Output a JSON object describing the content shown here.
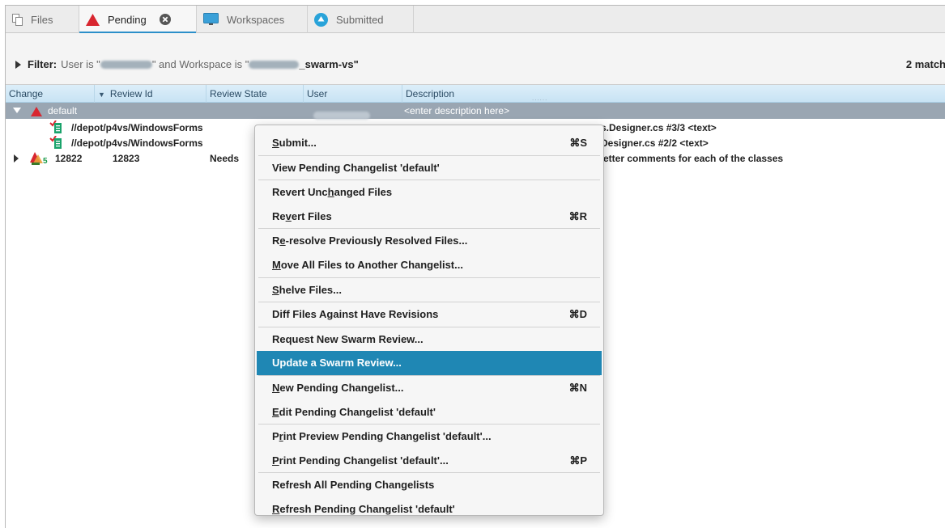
{
  "tabs": [
    {
      "label": "Files",
      "icon": "files-icon"
    },
    {
      "label": "Pending",
      "icon": "pending-triangle-icon",
      "active": true
    },
    {
      "label": "Workspaces",
      "icon": "workspace-monitor-icon"
    },
    {
      "label": "Submitted",
      "icon": "submitted-up-icon"
    }
  ],
  "filter": {
    "prefix": "Filter:",
    "part1": "User is \"",
    "part2": "\" and Workspace is \"",
    "part3": "_swarm-vs\"",
    "matches": "2 match"
  },
  "columns": {
    "change": "Change",
    "review_id": "Review Id",
    "review_state": "Review State",
    "user": "User",
    "description": "Description",
    "grip": "......"
  },
  "rows": {
    "default_name": "default",
    "default_desc": "<enter description here>",
    "file1_path": "//depot/p4vs/WindowsForms",
    "file1_tail": "s.Designer.cs #3/3 <text>",
    "file2_path": "//depot/p4vs/WindowsForms",
    "file2_tail": "Designer.cs #2/2 <text>",
    "cl_number": "12822",
    "cl_badge": "5",
    "cl_review_id": "12823",
    "cl_state": "Needs",
    "cl_desc_tail": "etter comments for each of the classes"
  },
  "menu": {
    "items": [
      {
        "pre": "",
        "u": "S",
        "post": "ubmit...",
        "shortcut": "⌘S"
      },
      {
        "pre": "View Pending Changelist 'default'",
        "u": "",
        "post": "",
        "shortcut": ""
      },
      {
        "pre": "Revert Unc",
        "u": "h",
        "post": "anged Files",
        "shortcut": ""
      },
      {
        "pre": "Re",
        "u": "v",
        "post": "ert Files",
        "shortcut": "⌘R"
      },
      {
        "pre": "R",
        "u": "e",
        "post": "-resolve Previously Resolved Files...",
        "shortcut": ""
      },
      {
        "pre": "",
        "u": "M",
        "post": "ove All Files to Another Changelist...",
        "shortcut": ""
      },
      {
        "pre": "",
        "u": "S",
        "post": "helve Files...",
        "shortcut": ""
      },
      {
        "pre": "Diff Files Against Have Revisions",
        "u": "",
        "post": "",
        "shortcut": "⌘D"
      },
      {
        "pre": "Request New Swarm Review...",
        "u": "",
        "post": "",
        "shortcut": ""
      },
      {
        "pre": "Update a Swarm Review...",
        "u": "",
        "post": "",
        "shortcut": ""
      },
      {
        "pre": "",
        "u": "N",
        "post": "ew Pending Changelist...",
        "shortcut": "⌘N"
      },
      {
        "pre": "",
        "u": "E",
        "post": "dit Pending Changelist 'default'",
        "shortcut": ""
      },
      {
        "pre": "P",
        "u": "r",
        "post": "int Preview Pending Changelist 'default'...",
        "shortcut": ""
      },
      {
        "pre": "",
        "u": "P",
        "post": "rint Pending Changelist 'default'...",
        "shortcut": "⌘P"
      },
      {
        "pre": "Refresh All Pending Changelists",
        "u": "",
        "post": "",
        "shortcut": ""
      },
      {
        "pre": "",
        "u": "R",
        "post": "efresh Pending Changelist 'default'",
        "shortcut": ""
      }
    ]
  },
  "colors": {
    "accent": "#1f87b4",
    "tab_underline": "#2b8fc9",
    "selection_row": "#9aa6b2",
    "header_bg": "#c8e3f4",
    "pending_red": "#d8262f"
  }
}
